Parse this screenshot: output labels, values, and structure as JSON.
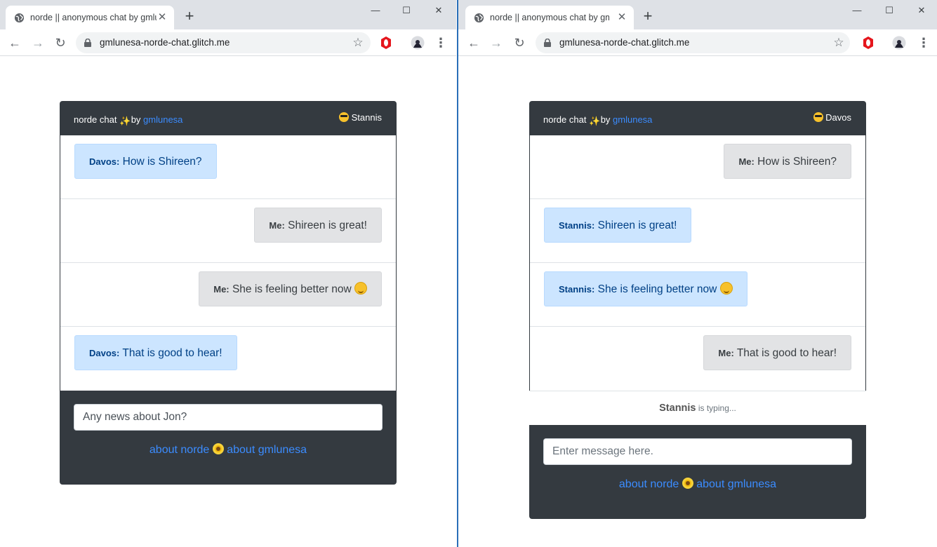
{
  "left_window": {
    "tab_title": "norde || anonymous chat by gmlunesa",
    "url": "gmlunesa-norde-chat.glitch.me",
    "chat": {
      "brand": "norde chat",
      "by": "by",
      "author": "gmlunesa",
      "user": "Stannis",
      "messages": [
        {
          "sender": "Davos:",
          "text": "How is Shireen?"
        },
        {
          "sender": "Me:",
          "text": "Shireen is great!"
        },
        {
          "sender": "Me:",
          "text": "She is feeling better now"
        },
        {
          "sender": "Davos:",
          "text": "That is good to hear!"
        }
      ],
      "input_value": "Any news about Jon?",
      "input_placeholder": "Enter message here.",
      "about_norde": "about norde",
      "about_author": "about gmlunesa"
    }
  },
  "right_window": {
    "tab_title": "norde || anonymous chat by gmlunesa",
    "url": "gmlunesa-norde-chat.glitch.me",
    "chat": {
      "brand": "norde chat",
      "by": "by",
      "author": "gmlunesa",
      "user": "Davos",
      "messages": [
        {
          "sender": "Me:",
          "text": "How is Shireen?"
        },
        {
          "sender": "Stannis:",
          "text": "Shireen is great!"
        },
        {
          "sender": "Stannis:",
          "text": "She is feeling better now"
        },
        {
          "sender": "Me:",
          "text": "That is good to hear!"
        }
      ],
      "typing_user": "Stannis",
      "typing_text": "is typing...",
      "input_value": "",
      "input_placeholder": "Enter message here.",
      "about_norde": "about norde",
      "about_author": "about gmlunesa"
    }
  },
  "icons": {
    "favicon": "globe-icon",
    "tab_close": "close-icon",
    "new_tab": "plus-icon",
    "back": "arrow-left-icon",
    "forward": "arrow-right-icon",
    "reload": "reload-icon",
    "lock": "lock-icon",
    "star": "star-icon",
    "extension": "opera-icon",
    "profile": "avatar-icon",
    "menu": "kebab-menu-icon"
  },
  "colors": {
    "card_bg": "#343a40",
    "link": "#3b8cff",
    "incoming_bubble": "#cce5ff",
    "outgoing_bubble": "#e2e3e5"
  }
}
